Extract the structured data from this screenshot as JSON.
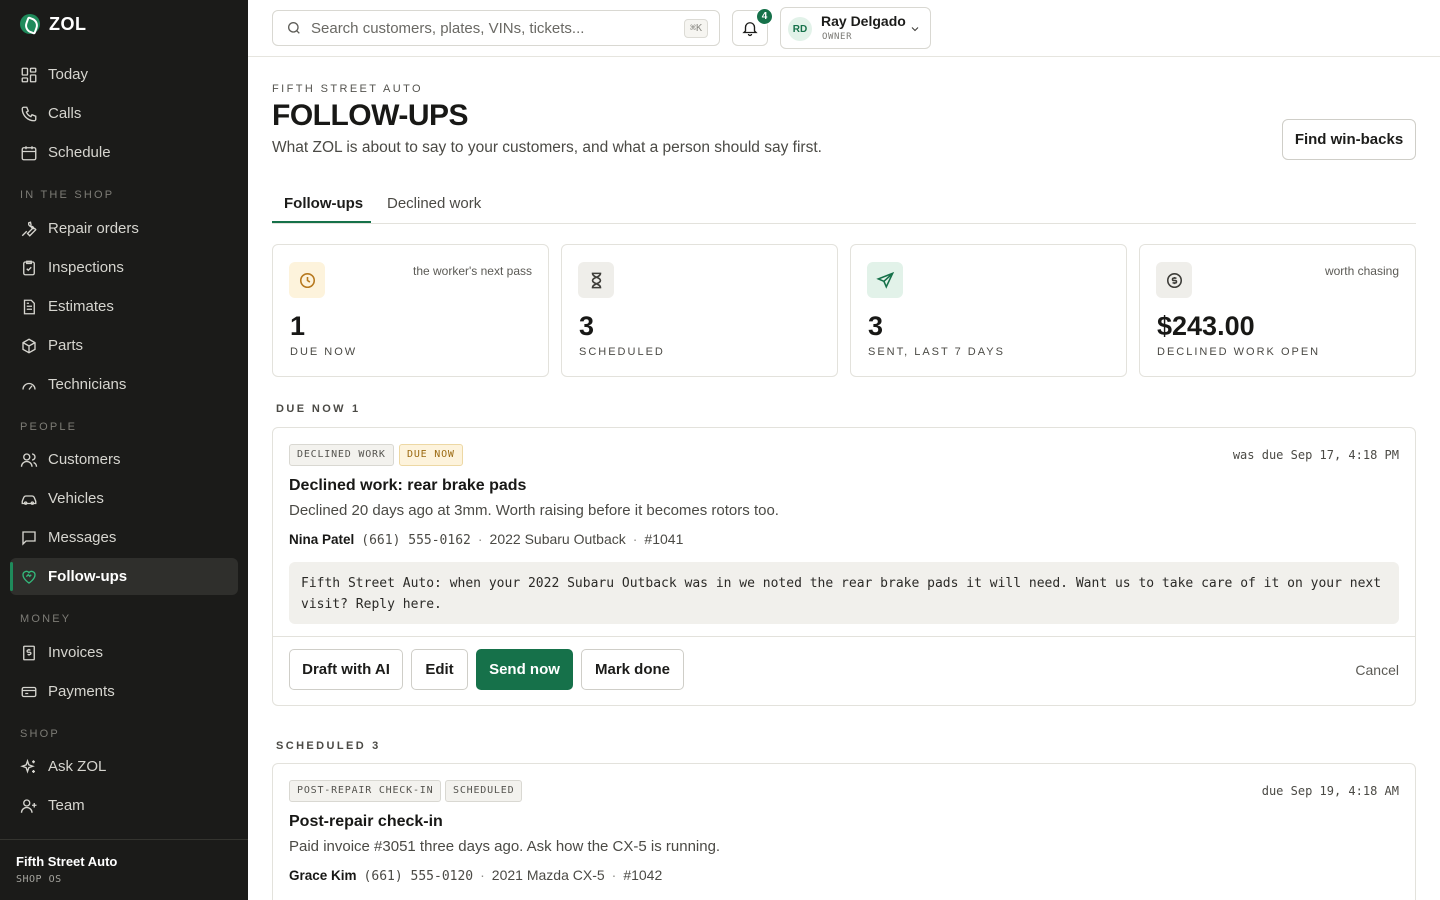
{
  "app": {
    "name": "ZOL"
  },
  "sidebar": {
    "top_items": [
      {
        "label": "Today",
        "icon": "grid-icon"
      },
      {
        "label": "Calls",
        "icon": "phone-icon"
      },
      {
        "label": "Schedule",
        "icon": "calendar-icon"
      }
    ],
    "sections": {
      "in_the_shop": "IN THE SHOP",
      "people": "PEOPLE",
      "money": "MONEY",
      "shop": "SHOP"
    },
    "shop_items": [
      {
        "label": "Repair orders",
        "icon": "wrench-icon"
      },
      {
        "label": "Inspections",
        "icon": "clipboard-check-icon"
      },
      {
        "label": "Estimates",
        "icon": "document-icon"
      },
      {
        "label": "Parts",
        "icon": "package-icon"
      },
      {
        "label": "Technicians",
        "icon": "gauge-icon"
      }
    ],
    "people_items": [
      {
        "label": "Customers",
        "icon": "users-icon"
      },
      {
        "label": "Vehicles",
        "icon": "car-icon"
      },
      {
        "label": "Messages",
        "icon": "message-icon"
      },
      {
        "label": "Follow-ups",
        "icon": "heart-handshake-icon",
        "active": true
      }
    ],
    "money_items": [
      {
        "label": "Invoices",
        "icon": "receipt-icon"
      },
      {
        "label": "Payments",
        "icon": "credit-card-icon"
      }
    ],
    "shop_section_items": [
      {
        "label": "Ask ZOL",
        "icon": "sparkles-icon"
      },
      {
        "label": "Team",
        "icon": "user-plus-icon"
      }
    ],
    "footer": {
      "shop_name": "Fifth Street Auto",
      "subtitle": "SHOP OS"
    }
  },
  "topbar": {
    "search_placeholder": "Search customers, plates, VINs, tickets...",
    "search_shortcut": "⌘K",
    "notifications_count": "4",
    "user": {
      "initials": "RD",
      "name": "Ray Delgado",
      "role": "OWNER"
    }
  },
  "header": {
    "eyebrow": "FIFTH STREET AUTO",
    "title": "FOLLOW-UPS",
    "subtitle": "What ZOL is about to say to your customers, and what a person should say first.",
    "action_label": "Find win-backs"
  },
  "tabs": [
    {
      "label": "Follow-ups",
      "active": true
    },
    {
      "label": "Declined work",
      "active": false
    }
  ],
  "stats": [
    {
      "icon": "clock-icon",
      "note": "the worker's next pass",
      "value": "1",
      "label": "DUE NOW",
      "color": "#b7791f",
      "bg": "#fdf3dc"
    },
    {
      "icon": "hourglass-icon",
      "note": "",
      "value": "3",
      "label": "SCHEDULED",
      "color": "#3f3e3a",
      "bg": "#efeeea"
    },
    {
      "icon": "send-icon",
      "note": "",
      "value": "3",
      "label": "SENT, LAST 7 DAYS",
      "color": "#16714a",
      "bg": "#e2f2e9"
    },
    {
      "icon": "dollar-circle-icon",
      "note": "worth chasing",
      "value": "$243.00",
      "label": "DECLINED WORK OPEN",
      "color": "#3f3e3a",
      "bg": "#efeeea"
    }
  ],
  "due_now": {
    "heading": "DUE NOW",
    "count": "1",
    "item": {
      "tags": [
        "DECLINED WORK",
        "DUE NOW"
      ],
      "due_text": "was due Sep 17, 4:18 PM",
      "title": "Declined work: rear brake pads",
      "description": "Declined 20 days ago at 3mm. Worth raising before it becomes rotors too.",
      "customer": "Nina Patel",
      "phone": "(661) 555-0162",
      "vehicle": "2022 Subaru Outback",
      "ticket": "#1041",
      "message": "Fifth Street Auto: when your 2022 Subaru Outback was in we noted the rear brake pads it will need. Want us to take care of it on your next visit? Reply here.",
      "actions": {
        "draft": "Draft with AI",
        "edit": "Edit",
        "send": "Send now",
        "done": "Mark done",
        "cancel": "Cancel"
      }
    }
  },
  "scheduled": {
    "heading": "SCHEDULED",
    "count": "3",
    "item": {
      "tags": [
        "POST-REPAIR CHECK-IN",
        "SCHEDULED"
      ],
      "due_text": "due Sep 19, 4:18 AM",
      "title": "Post-repair check-in",
      "description": "Paid invoice #3051 three days ago. Ask how the CX-5 is running.",
      "customer": "Grace Kim",
      "phone": "(661) 555-0120",
      "vehicle": "2021 Mazda CX-5",
      "ticket": "#1042"
    }
  },
  "separator": "·"
}
